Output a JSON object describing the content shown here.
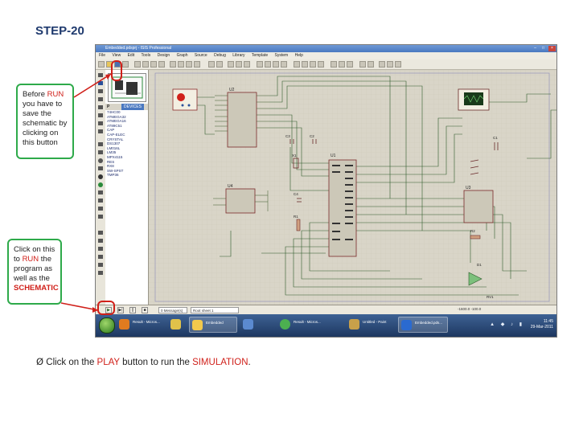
{
  "slide": {
    "title": "STEP-20",
    "callout1": {
      "line1_a": "Before ",
      "line1_b": "RUN",
      "rest": "you have to save the schematic by clicking on this button"
    },
    "callout2": {
      "line1": "Click  on this to ",
      "run": "RUN",
      "mid": " the program as well as the ",
      "schematic": "SCHEMATIC"
    },
    "bullet": {
      "arrow": "Ø",
      "pre": " Click on the ",
      "play": "PLAY",
      "mid": " button to run the ",
      "simulation": "SIMULATION",
      "post": "."
    }
  },
  "app": {
    "window_title": "Embedded.pdsprj - ISIS Professional",
    "window_buttons": [
      "–",
      "□",
      "×"
    ],
    "menu": [
      "File",
      "View",
      "Edit",
      "Tools",
      "Design",
      "Graph",
      "Source",
      "Debug",
      "Library",
      "Template",
      "System",
      "Help"
    ],
    "device_panel": {
      "mode": "P",
      "library_tab": "DEVICES",
      "items": [
        "74HC00",
        "ATMEGA32",
        "ATMEGA16",
        "AT89C51",
        "CAP",
        "CAP-ELEC",
        "CRYSTAL",
        "DS1307",
        "LM016L",
        "LM35",
        "MPX4115",
        "RES",
        "RX8",
        "SW-SPST",
        "TMP36"
      ]
    },
    "canvas_labels": {
      "u1": "U1",
      "u2": "U2",
      "u3": "U3",
      "u4": "U4",
      "c1": "C1",
      "c2": "C2",
      "c3": "C3",
      "c4": "C4",
      "x1": "X1",
      "r1": "R1",
      "r2": "R2",
      "d1": "D1",
      "rv1": "RV1"
    },
    "bottombar": {
      "play": "▶",
      "step": "▶|",
      "pause": "||",
      "stop": "■",
      "messages": "0 Message(s)",
      "status": "Root sheet 1",
      "coords": "-1600.0    -100.0"
    },
    "taskbar": {
      "items": [
        {
          "label": "Result - Micros...",
          "color": "#e07b1f"
        },
        {
          "label": "",
          "color": "#e0c24a"
        },
        {
          "label": "Embedded",
          "color": "#f2c94c"
        },
        {
          "label": "",
          "color": "#5b8ad0"
        },
        {
          "label": "Result - Micros...",
          "color": "#4caf50"
        },
        {
          "label": "Untitled - Paint",
          "color": "#c8a04a"
        },
        {
          "label": "Embedded.pds...",
          "color": "#2a6ad0"
        }
      ],
      "time": "11:45",
      "date": "29-Mar-2011"
    }
  }
}
